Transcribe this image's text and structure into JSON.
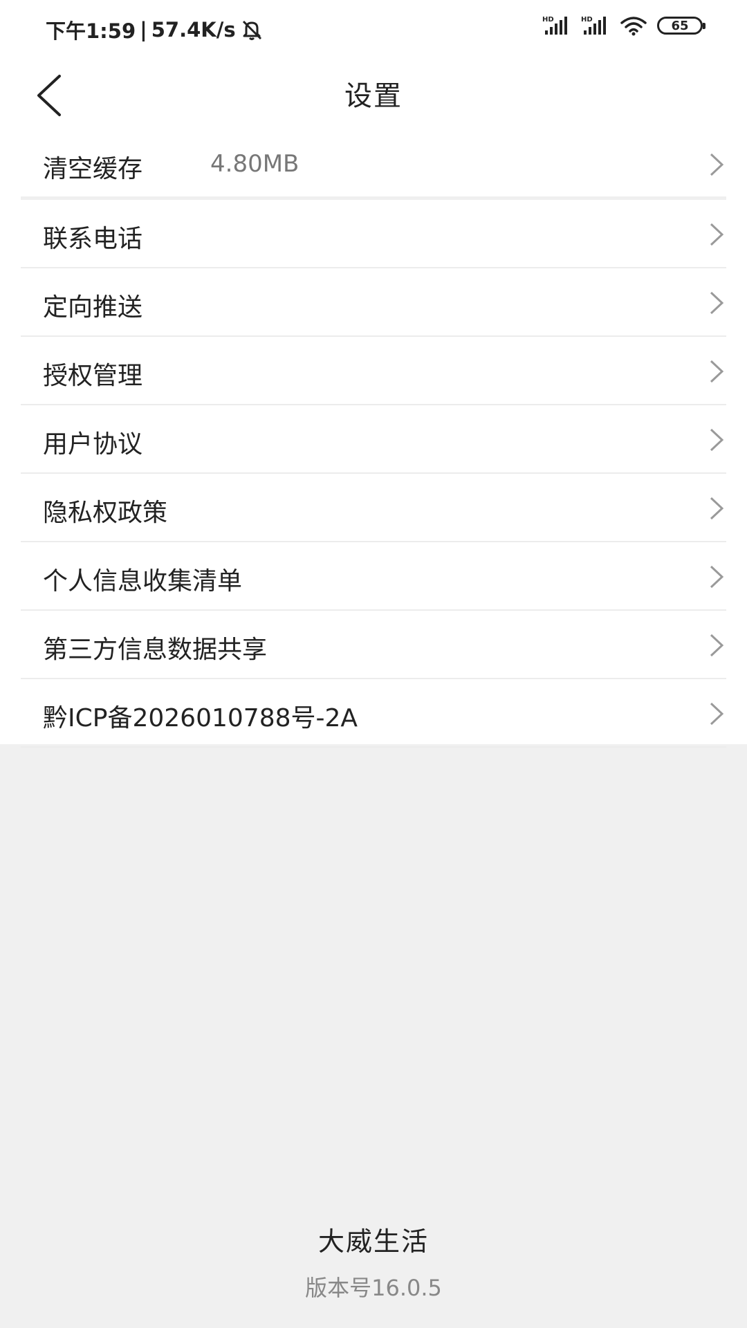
{
  "status_bar": {
    "time": "下午1:59",
    "separator": "|",
    "network_speed": "57.4K/s",
    "battery_level": "65",
    "icons": [
      "mute-icon",
      "hd-signal-icon",
      "hd-signal-icon",
      "wifi-icon",
      "battery-icon"
    ]
  },
  "header": {
    "title": "设置",
    "back_icon": "chevron-left-icon"
  },
  "settings": {
    "clear_cache": {
      "label": "清空缓存",
      "value": "4.80MB"
    },
    "items": [
      {
        "label": "联系电话"
      },
      {
        "label": "定向推送"
      },
      {
        "label": "授权管理"
      },
      {
        "label": "用户协议"
      },
      {
        "label": "隐私权政策"
      },
      {
        "label": "个人信息收集清单"
      },
      {
        "label": "第三方信息数据共享"
      },
      {
        "label": "黔ICP备2026010788号-2A"
      }
    ],
    "row_icon": "chevron-right-icon"
  },
  "footer": {
    "app_name": "大威生活",
    "version": "版本号16.0.5"
  },
  "colors": {
    "background": "#f0f0f0",
    "surface": "#ffffff",
    "text": "#222222",
    "muted": "#888888",
    "chevron": "#9a9a9a"
  }
}
